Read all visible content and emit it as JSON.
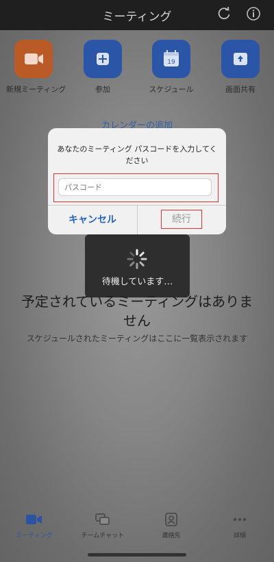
{
  "header": {
    "title": "ミーティング"
  },
  "actions": [
    {
      "label": "新規ミーティング",
      "icon": "video-camera-icon",
      "color": "#b95a27"
    },
    {
      "label": "参加",
      "icon": "plus-icon",
      "color": "#2b56a8"
    },
    {
      "label": "スケジュール",
      "icon": "calendar-icon",
      "color": "#2b56a8",
      "calendar_day": "19"
    },
    {
      "label": "画面共有",
      "icon": "share-screen-icon",
      "color": "#2b56a8"
    }
  ],
  "calendar_link": "カレンダーの追加",
  "dialog": {
    "message": "あなたのミーティング パスコードを入力してください",
    "passcode_placeholder": "パスコード",
    "passcode_value": "",
    "cancel_label": "キャンセル",
    "continue_label": "続行"
  },
  "toast": {
    "text": "待機しています…"
  },
  "empty_state": {
    "title": "予定されているミーティングはありません",
    "subtitle": "スケジュールされたミーティングはここに一覧表示されます"
  },
  "tabs": [
    {
      "label": "ミーティング",
      "icon": "video-camera-icon",
      "active": true
    },
    {
      "label": "チームチャット",
      "icon": "chat-bubbles-icon",
      "active": false
    },
    {
      "label": "連絡先",
      "icon": "contact-icon",
      "active": false
    },
    {
      "label": "詳細",
      "icon": "more-dots-icon",
      "active": false
    }
  ],
  "colors": {
    "accent": "#2b56a8",
    "link": "#2663c7",
    "highlight": "#e43030",
    "header_bg": "#1f1f1f"
  }
}
